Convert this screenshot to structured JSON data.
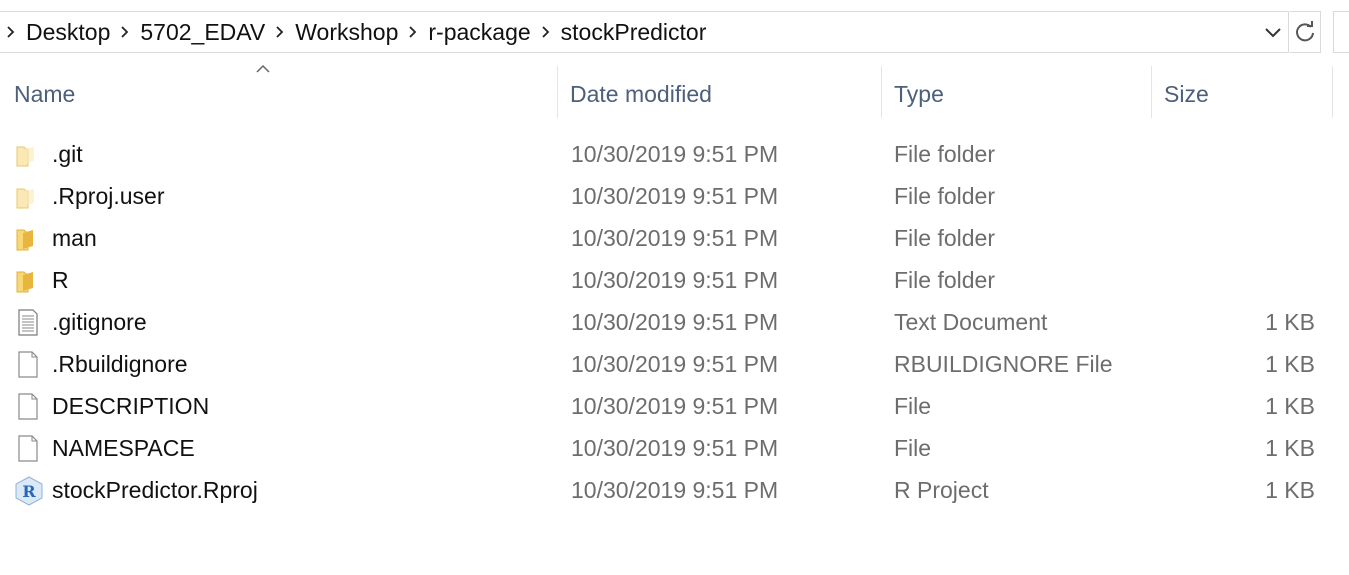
{
  "address": {
    "crumbs": [
      "Desktop",
      "5702_EDAV",
      "Workshop",
      "r-package",
      "stockPredictor"
    ]
  },
  "columns": {
    "name": "Name",
    "date": "Date modified",
    "type": "Type",
    "size": "Size"
  },
  "files": [
    {
      "name": ".git",
      "date": "10/30/2019 9:51 PM",
      "type": "File folder",
      "size": "",
      "icon": "folder-empty-icon"
    },
    {
      "name": ".Rproj.user",
      "date": "10/30/2019 9:51 PM",
      "type": "File folder",
      "size": "",
      "icon": "folder-empty-icon"
    },
    {
      "name": "man",
      "date": "10/30/2019 9:51 PM",
      "type": "File folder",
      "size": "",
      "icon": "folder-icon"
    },
    {
      "name": "R",
      "date": "10/30/2019 9:51 PM",
      "type": "File folder",
      "size": "",
      "icon": "folder-icon"
    },
    {
      "name": ".gitignore",
      "date": "10/30/2019 9:51 PM",
      "type": "Text Document",
      "size": "1 KB",
      "icon": "text-document-icon"
    },
    {
      "name": ".Rbuildignore",
      "date": "10/30/2019 9:51 PM",
      "type": "RBUILDIGNORE File",
      "size": "1 KB",
      "icon": "file-icon"
    },
    {
      "name": "DESCRIPTION",
      "date": "10/30/2019 9:51 PM",
      "type": "File",
      "size": "1 KB",
      "icon": "file-icon"
    },
    {
      "name": "NAMESPACE",
      "date": "10/30/2019 9:51 PM",
      "type": "File",
      "size": "1 KB",
      "icon": "file-icon"
    },
    {
      "name": "stockPredictor.Rproj",
      "date": "10/30/2019 9:51 PM",
      "type": "R Project",
      "size": "1 KB",
      "icon": "r-project-icon"
    }
  ],
  "colors": {
    "header_text": "#4c607a",
    "detail_text": "#6d6d6d",
    "folder_yellow": "#f8d775",
    "folder_pale": "#fbe9b5",
    "r_blue": "#2767b8"
  }
}
